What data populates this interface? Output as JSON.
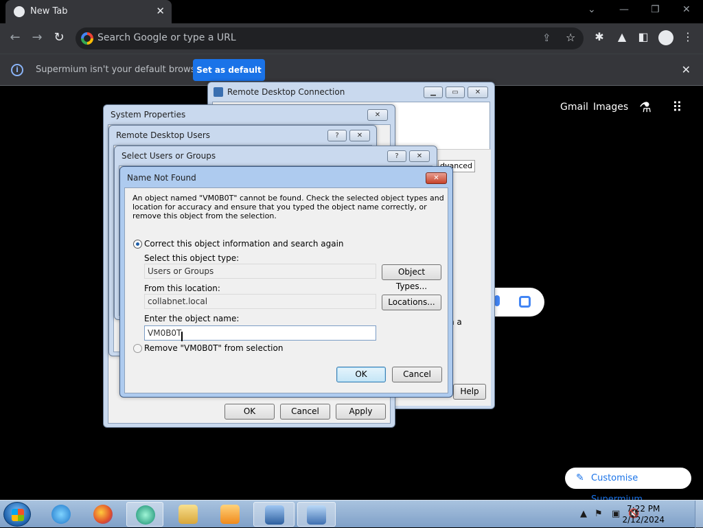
{
  "browser": {
    "tab_title": "New Tab",
    "omnibox_placeholder": "Search Google or type a URL",
    "infobar_message": "Supermium isn't your default browser",
    "infobar_button": "Set as default"
  },
  "ntp": {
    "gmail": "Gmail",
    "images": "Images",
    "customise": "Customise Supermium"
  },
  "dialogs": {
    "rdc_title": "Remote Desktop Connection",
    "rdc_advanced_tab": "dvanced",
    "rdc_text_fragment": "n a",
    "rdc_help": "Help",
    "sysprop_title": "System Properties",
    "sysprop_ok": "OK",
    "sysprop_cancel": "Cancel",
    "sysprop_apply": "Apply",
    "rdu_title": "Remote Desktop Users",
    "sug_title": "Select Users or Groups"
  },
  "name_not_found": {
    "title": "Name Not Found",
    "message": "An object named \"VM0B0T\" cannot be found. Check the selected object types and location for accuracy and ensure that you typed the object name correctly, or remove this object from the selection.",
    "radio_correct": "Correct this object information and search again",
    "object_type_label": "Select this object type:",
    "object_type_value": "Users or Groups",
    "object_types_button": "Object Types...",
    "location_label": "From this location:",
    "location_value": "collabnet.local",
    "locations_button": "Locations...",
    "object_name_label": "Enter the object name:",
    "object_name_value": "VM0B0T",
    "radio_remove": "Remove \"VM0B0T\" from selection",
    "ok": "OK",
    "cancel": "Cancel"
  },
  "taskbar": {
    "time": "7:22 PM",
    "date": "2/12/2024"
  }
}
